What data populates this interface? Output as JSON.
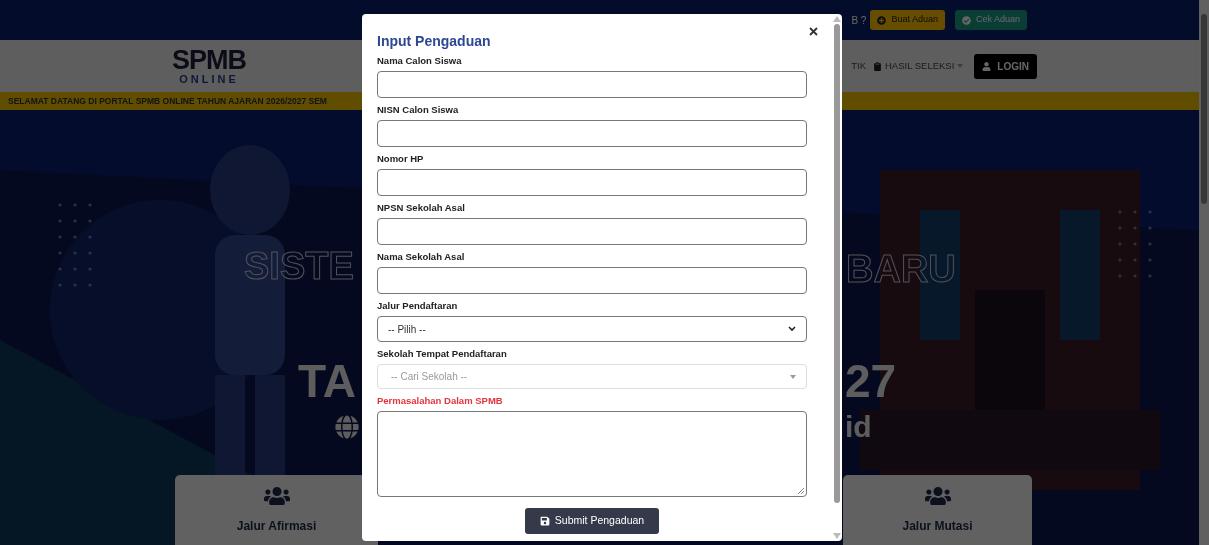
{
  "topbar": {
    "question_text": "B ?",
    "buttons": [
      {
        "label": "Buat Aduan",
        "kind": "warning"
      },
      {
        "label": "Cek Aduan",
        "kind": "success"
      }
    ]
  },
  "header": {
    "logo": {
      "title": "SPMB",
      "subtitle": "ONLINE"
    },
    "nav": [
      {
        "label": "TIK",
        "kind": "text"
      },
      {
        "label": "HASIL SELEKSI",
        "kind": "dropdown"
      }
    ],
    "login": "LOGIN"
  },
  "marquee": "SELAMAT DATANG DI PORTAL SPMB ONLINE TAHUN AJARAN 2026/2027 SEM",
  "hero": {
    "left_outline": "SISTE",
    "right_outline": "BARU",
    "left_year": "TA",
    "right_year": "27",
    "right_site": "id"
  },
  "cards": [
    {
      "label": "Jalur Afirmasi"
    },
    {
      "label": "Jalur Mutasi"
    }
  ],
  "modal": {
    "title": "Input Pengaduan",
    "fields": [
      {
        "label": "Nama Calon Siswa",
        "kind": "text",
        "invalid": false
      },
      {
        "label": "NISN Calon Siswa",
        "kind": "text",
        "invalid": false
      },
      {
        "label": "Nomor HP",
        "kind": "text",
        "invalid": false
      },
      {
        "label": "NPSN Sekolah Asal",
        "kind": "text",
        "invalid": false
      },
      {
        "label": "Nama Sekolah Asal",
        "kind": "text",
        "invalid": false
      },
      {
        "label": "Jalur Pendaftaran",
        "kind": "select",
        "value": "-- Pilih --",
        "invalid": false
      },
      {
        "label": "Sekolah Tempat Pendaftaran",
        "kind": "search-select",
        "placeholder": "-- Cari Sekolah --",
        "invalid": false
      },
      {
        "label": "Permasalahan Dalam SPMB",
        "kind": "textarea",
        "invalid": true
      }
    ],
    "submit": "Submit Pengaduan"
  }
}
